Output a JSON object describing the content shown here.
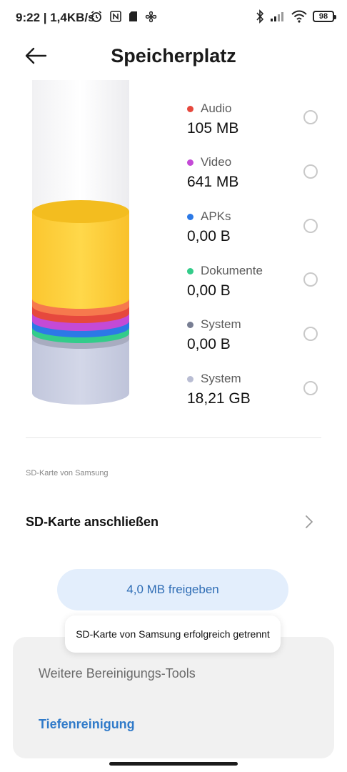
{
  "status": {
    "time": "9:22 | 1,4KB/s",
    "battery": "98",
    "left_icons": [
      "alarm-icon",
      "nfc-icon",
      "sd-card-icon",
      "fan-icon"
    ],
    "right_icons": [
      "bluetooth-icon",
      "signal-icon",
      "wifi-icon",
      "battery-icon"
    ]
  },
  "header": {
    "title": "Speicherplatz"
  },
  "storage": {
    "items": [
      {
        "label": "Audio",
        "value": "105 MB",
        "color": "#e6483d"
      },
      {
        "label": "Video",
        "value": "641 MB",
        "color": "#c44ad6"
      },
      {
        "label": "APKs",
        "value": "0,00 B",
        "color": "#2c79e6"
      },
      {
        "label": "Dokumente",
        "value": "0,00 B",
        "color": "#33cc8a"
      },
      {
        "label": "System",
        "value": "0,00 B",
        "color": "#787e93"
      },
      {
        "label": "System",
        "value": "18,21 GB",
        "color": "#b9bdd3"
      }
    ]
  },
  "sd_section": {
    "caption": "SD-Karte von Samsung",
    "connect_label": "SD-Karte anschließen"
  },
  "free_button": {
    "label": "4,0 MB freigeben"
  },
  "toast": {
    "text": "SD-Karte von Samsung erfolgreich getrennt"
  },
  "sheet": {
    "title": "Weitere Bereinigungs-Tools",
    "link": "Tiefenreinigung"
  }
}
